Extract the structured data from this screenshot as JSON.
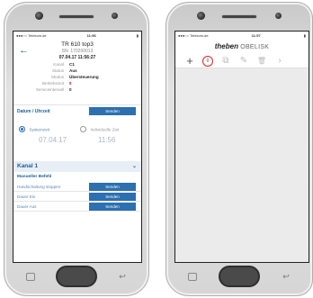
{
  "phoneA": {
    "status": {
      "carrier": "●●●○○ Telekom.de",
      "time": "11:56",
      "battery": "▮"
    },
    "device": {
      "title": "TR 610 top3",
      "serial": "SN: 170200013",
      "datetime": "07.04.17 11:56:27",
      "fields": [
        {
          "key": "Kanal",
          "value": "C1",
          "highlight": false
        },
        {
          "key": "Status",
          "value": "Aus",
          "highlight": false
        },
        {
          "key": "Modus",
          "value": "Übersteuerung",
          "highlight": false
        },
        {
          "key": "Betriebszeit",
          "value": "8",
          "highlight": true
        },
        {
          "key": "Serviceintervall",
          "value": "0",
          "highlight": false
        }
      ]
    },
    "date_section": {
      "title": "Datum / Uhrzeit",
      "send_label": "Senden",
      "option_system": "Systemzeit",
      "option_custom": "Individuelle Zeit",
      "date_value": "07.04.17",
      "time_value": "11:56"
    },
    "kanal": {
      "title": "Kanal 1",
      "chevron": "⌄",
      "manual_title": "Manueller Befehl",
      "commands": [
        {
          "label": "Handschaltung stoppen",
          "button": "Senden"
        },
        {
          "label": "Dauer Ein",
          "button": "Senden"
        },
        {
          "label": "Dauer Aus",
          "button": "Senden"
        }
      ]
    }
  },
  "phoneB": {
    "status": {
      "carrier": "●●●○○ Telekom.de",
      "time": "11:57",
      "battery": "▮"
    },
    "brand": {
      "logo": "theben",
      "product": "OBELISK"
    },
    "toolbar": {
      "add": "+",
      "download": "⇩",
      "copy": "⧉",
      "edit": "✎",
      "delete": "🗑",
      "more": "›"
    }
  },
  "colors": {
    "accent": "#2d6fb0",
    "highlight": "#d7262b",
    "warning": "#d22222"
  }
}
